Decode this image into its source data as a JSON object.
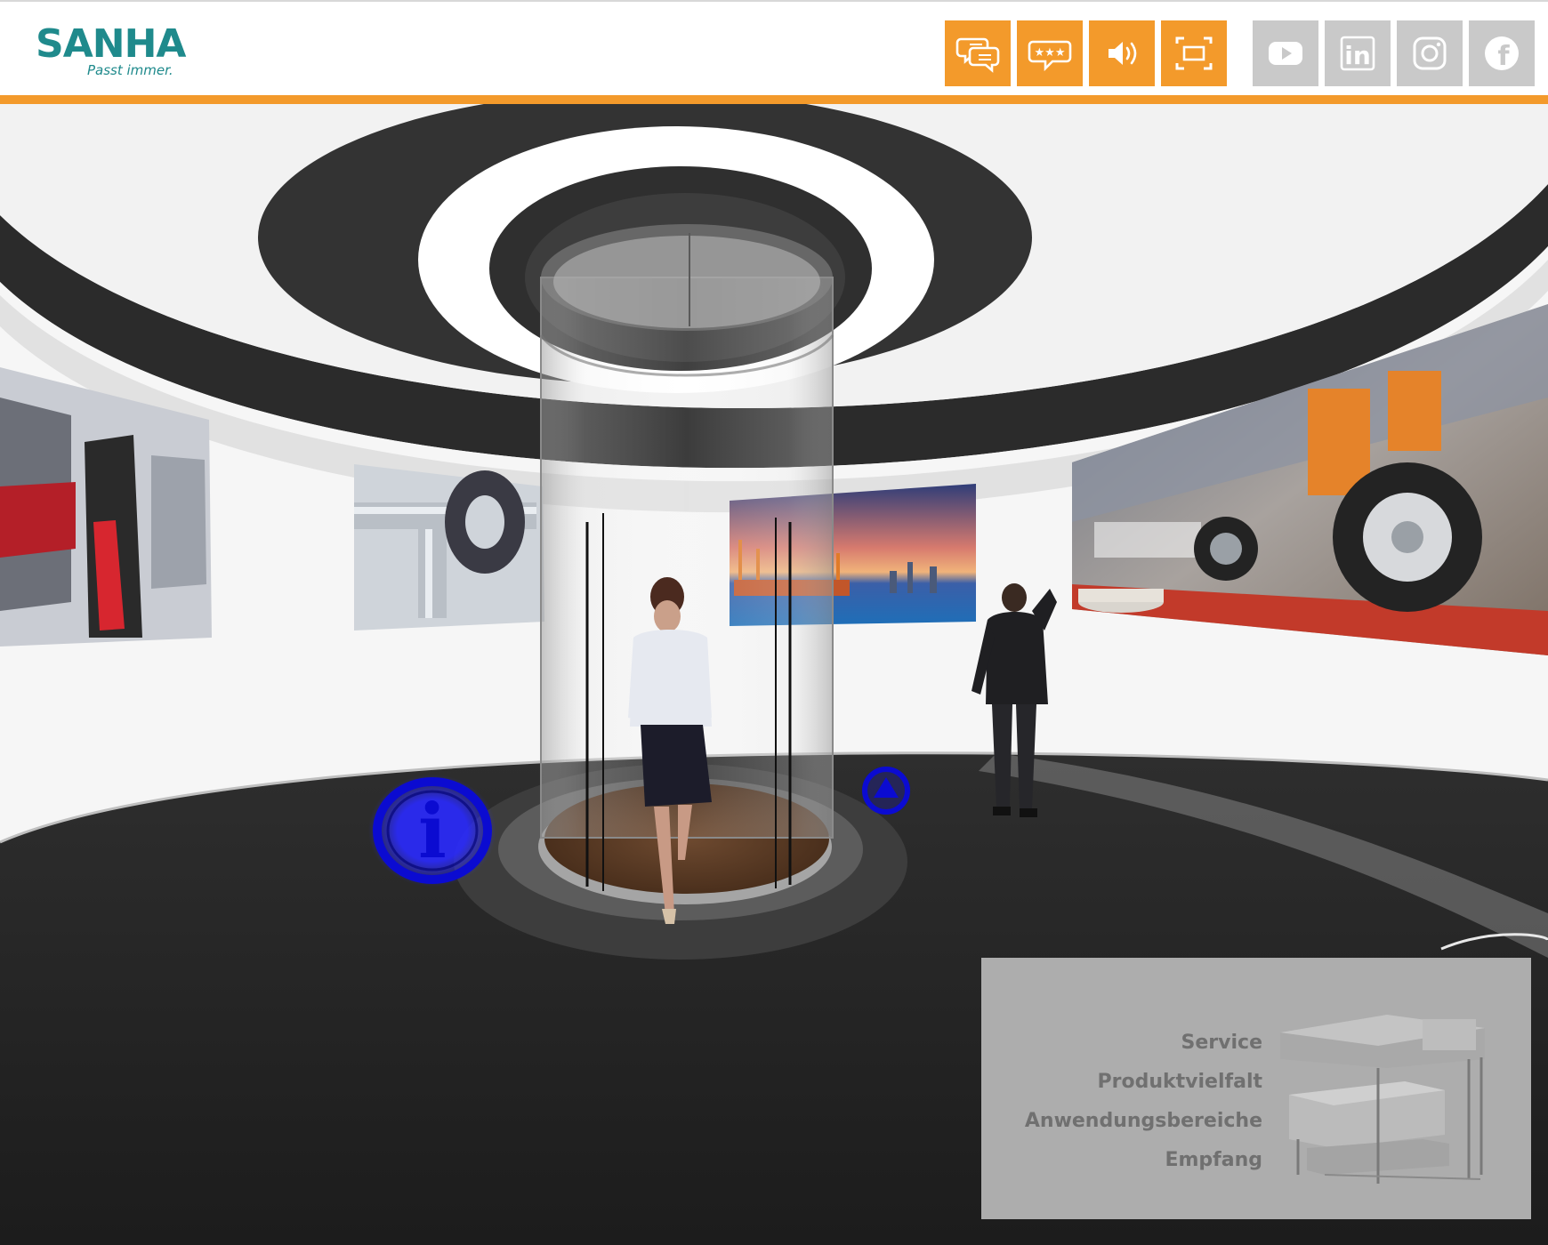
{
  "brand": {
    "name": "SANHA",
    "tagline": "Passt immer.",
    "brand_color": "#1f8a8c",
    "accent_color": "#f39a2b"
  },
  "toolbar": {
    "primary": [
      {
        "name": "chat",
        "icon": "chat-bubbles-icon"
      },
      {
        "name": "rating",
        "icon": "star-rating-bubble-icon"
      },
      {
        "name": "sound",
        "icon": "speaker-icon"
      },
      {
        "name": "fullscreen",
        "icon": "fullscreen-icon"
      }
    ],
    "social": [
      {
        "name": "youtube",
        "icon": "youtube-icon"
      },
      {
        "name": "linkedin",
        "icon": "linkedin-icon",
        "label": "in"
      },
      {
        "name": "instagram",
        "icon": "instagram-icon"
      },
      {
        "name": "facebook",
        "icon": "facebook-icon",
        "label": "f"
      }
    ]
  },
  "scene": {
    "hotspots": [
      {
        "name": "info",
        "icon": "info-icon",
        "label": "i",
        "color": "#1a1ad8"
      },
      {
        "name": "up",
        "icon": "arrow-up-icon",
        "color": "#1a1ad8"
      }
    ]
  },
  "nav_panel": {
    "items": [
      "Service",
      "Produktvielfalt",
      "Anwendungsbereiche",
      "Empfang"
    ]
  }
}
